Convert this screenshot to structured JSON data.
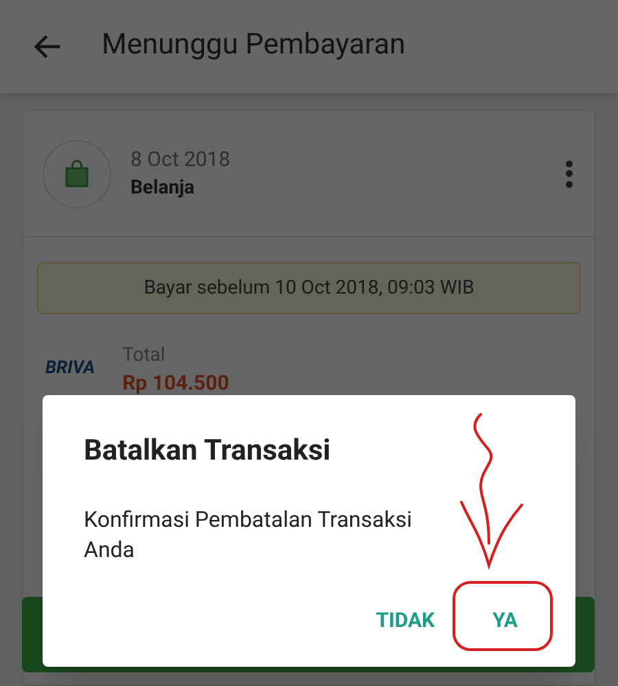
{
  "app_bar": {
    "title": "Menunggu Pembayaran"
  },
  "order": {
    "date": "8 Oct 2018",
    "category": "Belanja"
  },
  "deadline": "Bayar sebelum 10 Oct 2018, 09:03 WIB",
  "payment": {
    "logo": "BRIVA",
    "label": "Total",
    "amount": "Rp 104.500"
  },
  "dialog": {
    "title": "Batalkan Transaksi",
    "message": "Konfirmasi Pembatalan Transaksi Anda",
    "buttons": [
      "TIDAK",
      "YA"
    ]
  }
}
